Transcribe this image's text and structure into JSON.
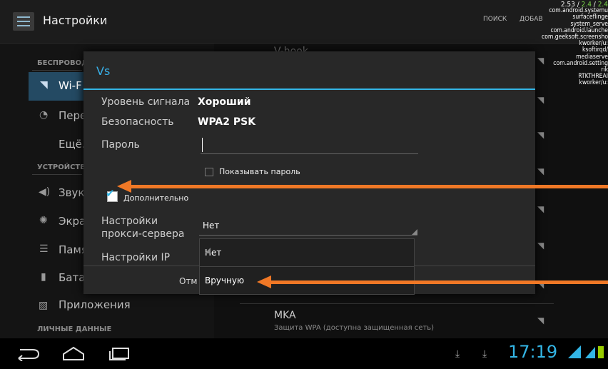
{
  "action_bar": {
    "title": "Настройки",
    "search_label": "ПОИСК",
    "add_label": "ДОБАВ"
  },
  "debug_overlay": {
    "fps": [
      "2.53",
      "2.4",
      "2.4"
    ],
    "processes": [
      "com.android.systemu",
      "surfaceflinge",
      "system_serve",
      "com.android.launche",
      "com.geeksoft.screensho",
      "kworker/u:",
      "ksoftirqd/",
      "mediaserve",
      "com.android.setting",
      "rik",
      "RTKTHREAI",
      "kworker/u:"
    ]
  },
  "left_pane": {
    "header_wireless": "БЕСПРОВОД",
    "item_wifi": "Wi-F",
    "item_data": "Пере",
    "item_more": "Ещё.",
    "header_device": "УСТРОЙСТВ",
    "item_sound": "Звук",
    "item_screen": "Экра",
    "item_memory": "Памя",
    "item_battery": "Бата",
    "item_apps": "Приложения",
    "header_personal": "ЛИЧНЫЕ ДАННЫЕ"
  },
  "right_pane": {
    "top_network": "V-hook",
    "bottom_network": {
      "name": "MKA",
      "security": "Защита WPA (доступна защищенная сеть)"
    }
  },
  "dialog": {
    "title": "Vs",
    "signal_label": "Уровень сигнала",
    "signal_value": "Хороший",
    "security_label": "Безопасность",
    "security_value": "WPA2 PSK",
    "password_label": "Пароль",
    "password_value": "",
    "show_password_label": "Показывать пароль",
    "show_password_checked": false,
    "advanced_label": "Дополнительно",
    "advanced_checked": true,
    "proxy_label_line1": "Настройки",
    "proxy_label_line2": "прокси-сервера",
    "proxy_value": "Нет",
    "ip_label": "Настройки IP",
    "cancel_label": "Отм",
    "popup_options": [
      "Нет",
      "Вручную"
    ]
  },
  "status_bar": {
    "clock": "17:19"
  },
  "colors": {
    "accent": "#33b5e5",
    "arrow": "#f07826",
    "wifi_selected": "#244a63"
  }
}
